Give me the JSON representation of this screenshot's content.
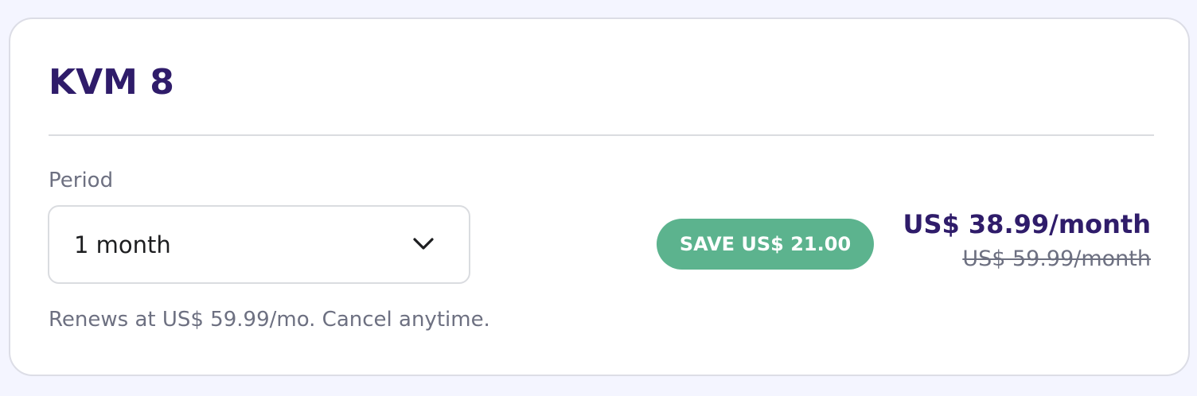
{
  "plan": {
    "title": "KVM 8"
  },
  "period": {
    "label": "Period",
    "selected": "1 month"
  },
  "renewal": {
    "text": "Renews at US$ 59.99/mo. Cancel anytime."
  },
  "pricing": {
    "save_badge": "SAVE US$ 21.00",
    "current_price": "US$ 38.99/month",
    "original_price": "US$ 59.99/month"
  },
  "icons": {
    "dropdown": "chevron-down-icon"
  },
  "colors": {
    "title": "#2f1c6a",
    "badge": "#5cb38e",
    "muted_text": "#6d7081",
    "page_background": "#f4f5ff"
  }
}
